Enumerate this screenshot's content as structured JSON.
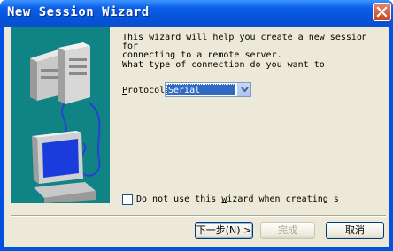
{
  "window": {
    "title": "New Session Wizard"
  },
  "intro_text": "This wizard will help you create a new session for\nconnecting to a remote server.",
  "question": "What type of connection do you want to",
  "protocol": {
    "label_prefix": "P",
    "label_rest": "rotocol",
    "selected": "Serial"
  },
  "skip_checkbox": {
    "pre": "Do not use this ",
    "accel": "w",
    "post": "izard when creating s",
    "checked": false
  },
  "buttons": {
    "next": "下一步(N) >",
    "finish": "完成",
    "cancel": "取消"
  },
  "colors": {
    "title_bar": "#0a5fe8",
    "panel": "#ece9d8",
    "art_bg": "#108484",
    "select_highlight": "#316ac5"
  }
}
